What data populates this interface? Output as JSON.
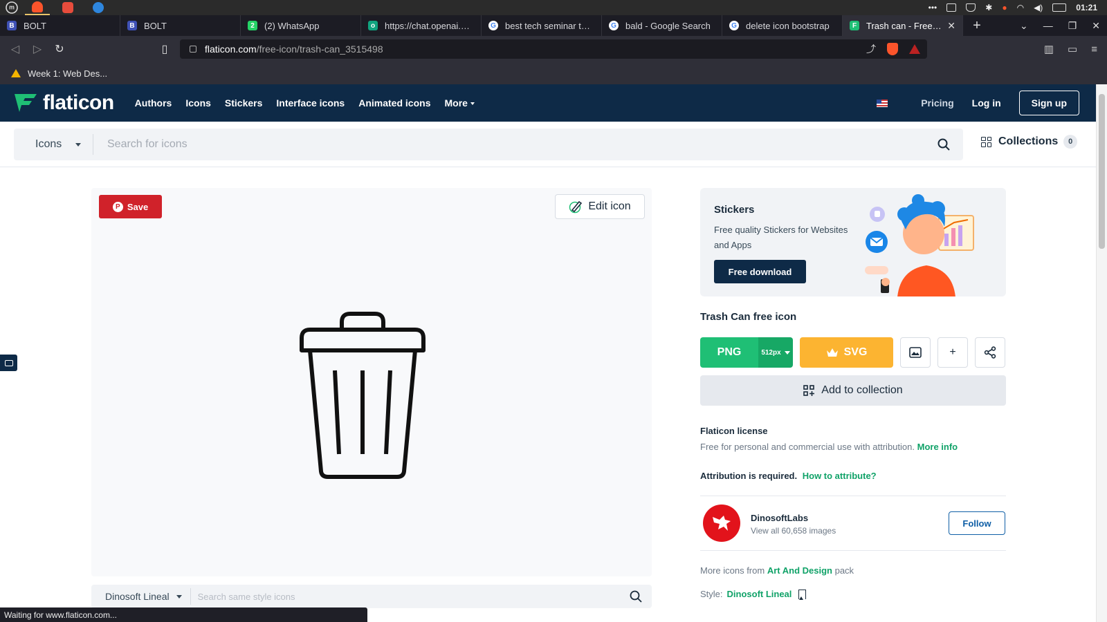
{
  "os": {
    "launcher_glyph": "m",
    "clock": "01:21",
    "apps": [
      {
        "name": "brave",
        "color": "#fb542b"
      },
      {
        "name": "wifi-tool",
        "color": "#e74c3c"
      },
      {
        "name": "browser-alt",
        "color": "#2e86de"
      }
    ]
  },
  "browser": {
    "tabs": [
      {
        "title": "BOLT",
        "icon": "bolt-b-icon",
        "color": "#3f51b5",
        "glyph": "B"
      },
      {
        "title": "BOLT",
        "icon": "bolt-b-icon",
        "color": "#3f51b5",
        "glyph": "B"
      },
      {
        "title": "(2) WhatsApp",
        "icon": "whatsapp-icon",
        "color": "#25d366",
        "glyph": "2"
      },
      {
        "title": "https://chat.openai.com",
        "icon": "openai-icon",
        "color": "#10a37f",
        "glyph": "o"
      },
      {
        "title": "best tech seminar topic",
        "icon": "google-icon",
        "color": "#ffffff",
        "glyph": "G"
      },
      {
        "title": "bald - Google Search",
        "icon": "google-icon",
        "color": "#ffffff",
        "glyph": "G"
      },
      {
        "title": "delete icon bootstrap",
        "icon": "google-icon",
        "color": "#ffffff",
        "glyph": "G"
      },
      {
        "title": "Trash can - Free ui i",
        "icon": "flaticon-icon",
        "color": "#1fbf75",
        "glyph": "F",
        "active": true
      }
    ],
    "new_tab_glyph": "+",
    "url": {
      "host": "flaticon.com",
      "path": "/free-icon/trash-can_3515498"
    },
    "bookmarks": [
      {
        "label": "Week 1: Web Des..."
      }
    ],
    "status": "Waiting for www.flaticon.com..."
  },
  "site": {
    "logo": "flaticon",
    "nav": [
      {
        "label": "Authors"
      },
      {
        "label": "Icons"
      },
      {
        "label": "Stickers"
      },
      {
        "label": "Interface icons"
      },
      {
        "label": "Animated icons"
      },
      {
        "label": "More"
      }
    ],
    "pricing": "Pricing",
    "login": "Log in",
    "signup": "Sign up",
    "search": {
      "type": "Icons",
      "placeholder": "Search for icons"
    },
    "collections": {
      "label": "Collections",
      "count": "0"
    }
  },
  "preview": {
    "save_label": "Save",
    "edit_label": "Edit icon",
    "style_select": "Dinosoft Lineal",
    "style_placeholder": "Search same style icons"
  },
  "sidebar": {
    "sticker": {
      "title": "Stickers",
      "desc": "Free quality Stickers for Websites and Apps",
      "cta": "Free download"
    },
    "icon_title": "Trash Can free icon",
    "png_label": "PNG",
    "png_size": "512px",
    "svg_label": "SVG",
    "add_collection": "Add to collection",
    "license_title": "Flaticon license",
    "license_text": "Free for personal and commercial use with attribution.",
    "more_info": "More info",
    "attribution": "Attribution is required.",
    "how_to": "How to attribute?",
    "author": {
      "name": "DinosoftLabs",
      "count": "View all 60,658 images",
      "follow": "Follow"
    },
    "pack_prefix": "More icons from",
    "pack_name": "Art And Design",
    "pack_suffix": "pack",
    "style_prefix": "Style:",
    "style_name": "Dinosoft Lineal"
  }
}
